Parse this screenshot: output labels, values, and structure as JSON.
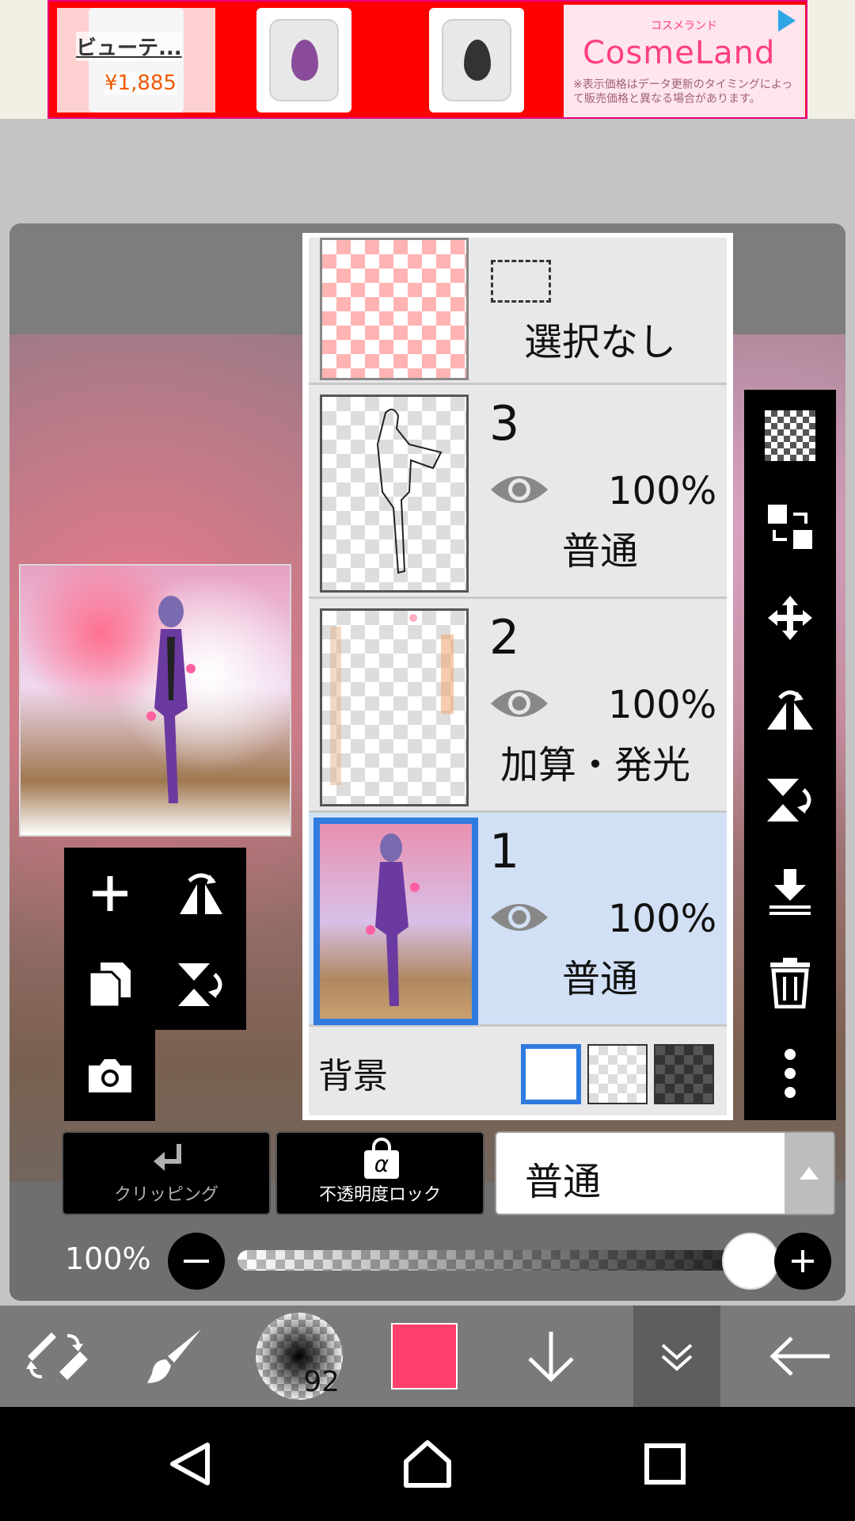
{
  "ad": {
    "product_title": "ビューテ...",
    "product_price": "¥1,885",
    "brand": "CosmeLand",
    "brand_kana": "コスメランド",
    "brand_note": "※表示価格はデータ更新のタイミングによって販売価格と異なる場合があります。"
  },
  "layers": {
    "selection_label": "選択なし",
    "items": [
      {
        "number": "3",
        "opacity": "100%",
        "blend": "普通"
      },
      {
        "number": "2",
        "opacity": "100%",
        "blend": "加算・発光"
      },
      {
        "number": "1",
        "opacity": "100%",
        "blend": "普通"
      }
    ],
    "background_label": "背景"
  },
  "controls": {
    "clipping_label": "クリッピング",
    "alpha_lock_label": "不透明度ロック",
    "alpha_symbol": "α",
    "blend_mode": "普通",
    "opacity_label": "100%",
    "opacity_value": 1.0
  },
  "toolbar": {
    "brush_size": "92",
    "color": "#ff3f6c"
  },
  "colors": {
    "accent_blue": "#2f7be0",
    "selected_layer_bg": "#d2e0f5",
    "ad_red": "#ff0000"
  }
}
